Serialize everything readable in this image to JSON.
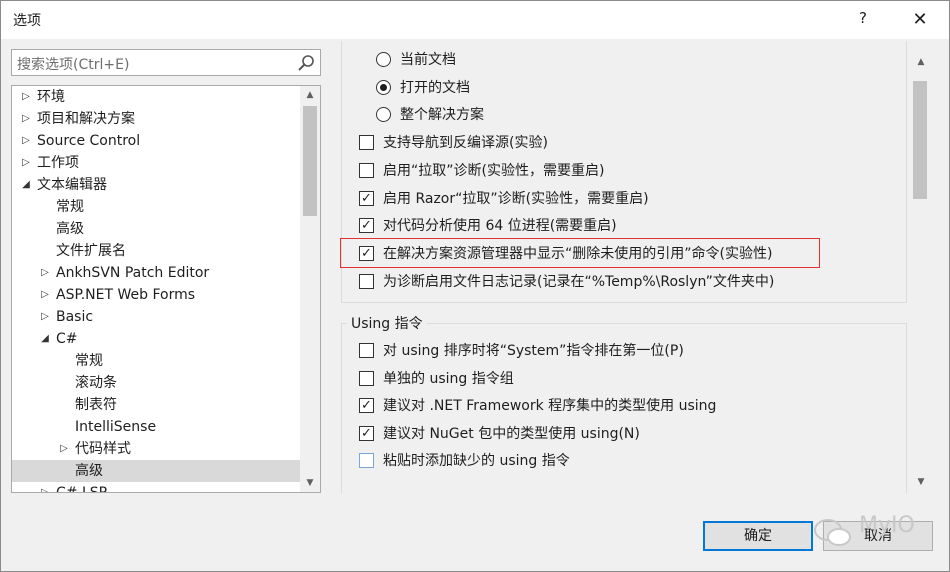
{
  "window": {
    "title": "选项",
    "help_label": "?",
    "close_label": "✕"
  },
  "search": {
    "placeholder": "搜索选项(Ctrl+E)"
  },
  "tree": {
    "items": [
      {
        "label": "环境",
        "arrow": "▷",
        "indent": 0
      },
      {
        "label": "项目和解决方案",
        "arrow": "▷",
        "indent": 0
      },
      {
        "label": "Source Control",
        "arrow": "▷",
        "indent": 0
      },
      {
        "label": "工作项",
        "arrow": "▷",
        "indent": 0
      },
      {
        "label": "文本编辑器",
        "arrow": "◢",
        "indent": 0
      },
      {
        "label": "常规",
        "arrow": "",
        "indent": 1
      },
      {
        "label": "高级",
        "arrow": "",
        "indent": 1
      },
      {
        "label": "文件扩展名",
        "arrow": "",
        "indent": 1
      },
      {
        "label": "AnkhSVN Patch Editor",
        "arrow": "▷",
        "indent": 1
      },
      {
        "label": "ASP.NET Web Forms",
        "arrow": "▷",
        "indent": 1
      },
      {
        "label": "Basic",
        "arrow": "▷",
        "indent": 1
      },
      {
        "label": "C#",
        "arrow": "◢",
        "indent": 1
      },
      {
        "label": "常规",
        "arrow": "",
        "indent": 2
      },
      {
        "label": "滚动条",
        "arrow": "",
        "indent": 2
      },
      {
        "label": "制表符",
        "arrow": "",
        "indent": 2
      },
      {
        "label": "IntelliSense",
        "arrow": "",
        "indent": 2
      },
      {
        "label": "代码样式",
        "arrow": "▷",
        "indent": 2
      },
      {
        "label": "高级",
        "arrow": "",
        "indent": 2,
        "selected": true
      },
      {
        "label": "C# LSP",
        "arrow": "▷",
        "indent": 1
      }
    ]
  },
  "options": {
    "radios": [
      {
        "label": "当前文档",
        "checked": false
      },
      {
        "label": "打开的文档",
        "checked": true
      },
      {
        "label": "整个解决方案",
        "checked": false
      }
    ],
    "checks": [
      {
        "label": "支持导航到反编译源(实验)",
        "checked": false
      },
      {
        "label": "启用“拉取”诊断(实验性，需要重启)",
        "checked": false
      },
      {
        "label": "启用 Razor“拉取”诊断(实验性，需要重启)",
        "checked": true
      },
      {
        "label": "对代码分析使用 64 位进程(需要重启)",
        "checked": true
      },
      {
        "label": "在解决方案资源管理器中显示“删除未使用的引用”命令(实验性)",
        "checked": true
      },
      {
        "label": "为诊断启用文件日志记录(记录在“%Temp%\\Roslyn”文件夹中)",
        "checked": false
      }
    ],
    "using_group_title": "Using 指令",
    "using_checks": [
      {
        "label": "对 using 排序时将“System”指令排在第一位(P)",
        "checked": false
      },
      {
        "label": "单独的 using 指令组",
        "checked": false
      },
      {
        "label": "建议对 .NET Framework 程序集中的类型使用 using",
        "checked": true
      },
      {
        "label": "建议对 NuGet 包中的类型使用 using(N)",
        "checked": true
      },
      {
        "label": "粘贴时添加缺少的 using 指令",
        "checked": false
      }
    ]
  },
  "buttons": {
    "ok": "确定",
    "cancel": "取消"
  },
  "watermark": "MyIO",
  "colors": {
    "highlight": "#e03030",
    "ok_border": "#0078d7"
  }
}
